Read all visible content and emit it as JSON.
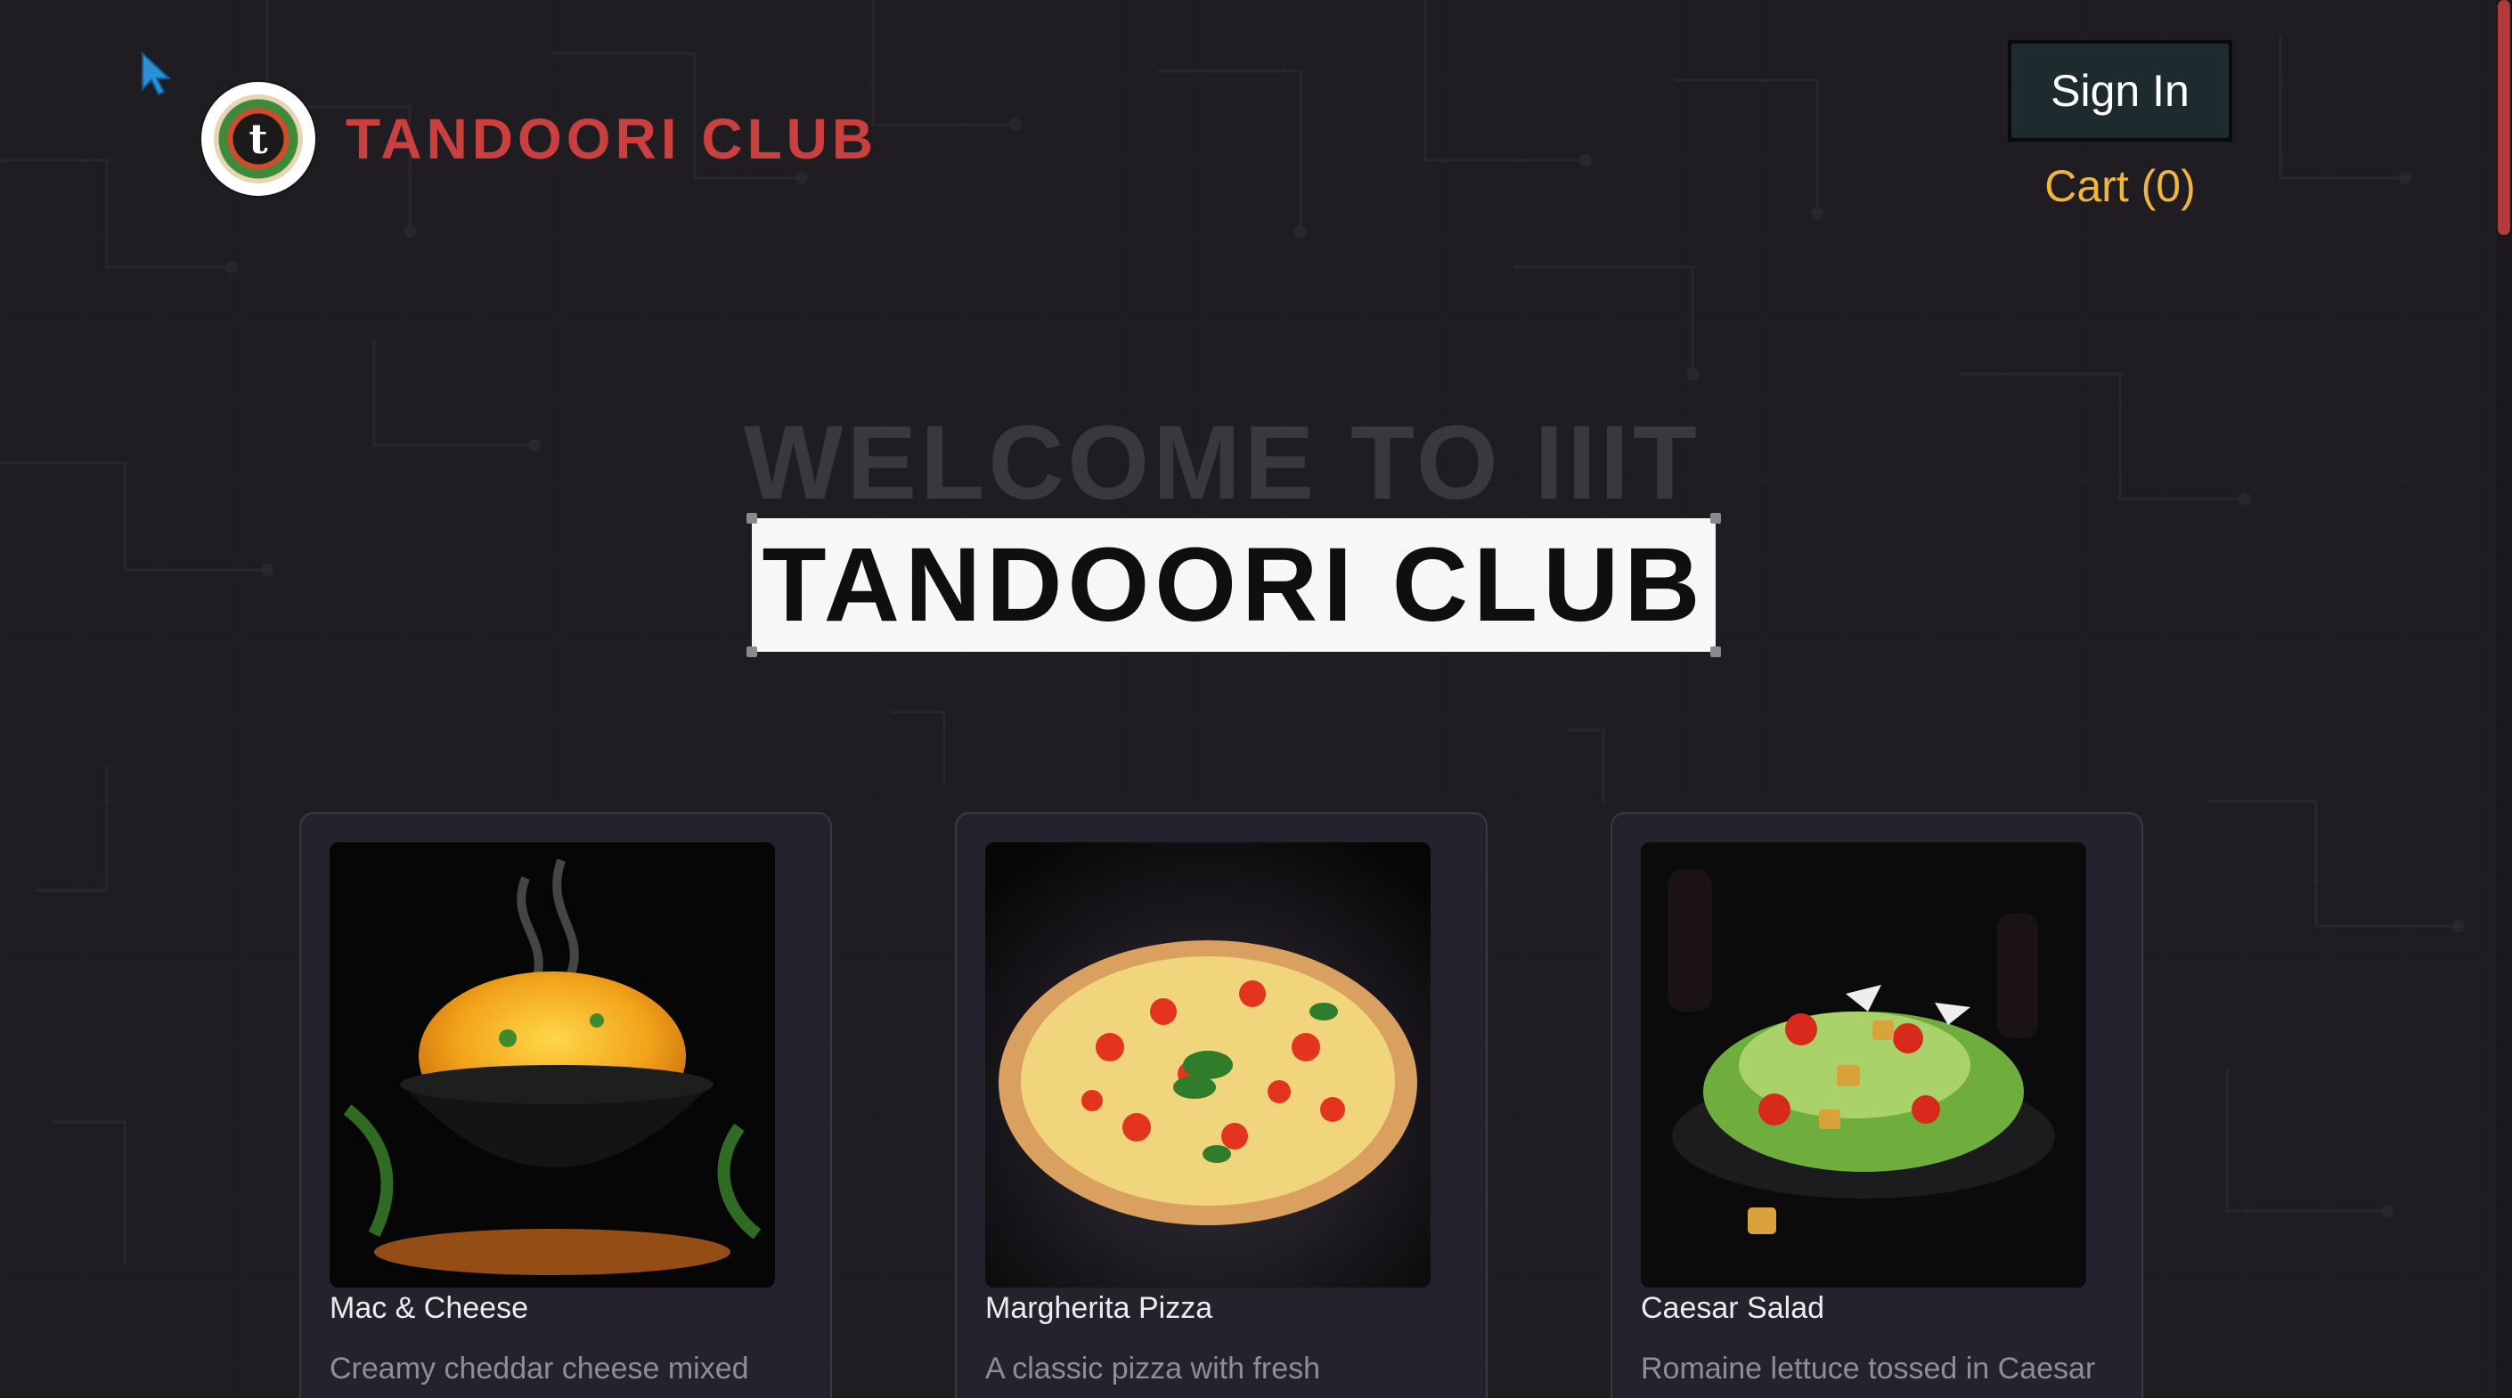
{
  "header": {
    "brand_name": "TANDOORI CLUB",
    "logo_letter": "t",
    "signin_label": "Sign In",
    "cart_label": "Cart (0)"
  },
  "hero": {
    "welcome": "WELCOME TO IIIT",
    "title": "TANDOORI CLUB"
  },
  "colors": {
    "background": "#1f1d22",
    "brand": "#c9403f",
    "cart": "#f2b53a",
    "card": "#25222d"
  },
  "menu": [
    {
      "name": "Mac & Cheese",
      "description": "Creamy cheddar cheese mixed with",
      "image_icon": "mac-and-cheese-image"
    },
    {
      "name": "Margherita Pizza",
      "description": "A classic pizza with fresh",
      "image_icon": "pizza-image"
    },
    {
      "name": "Caesar Salad",
      "description": "Romaine lettuce tossed in Caesar",
      "image_icon": "salad-image"
    }
  ]
}
